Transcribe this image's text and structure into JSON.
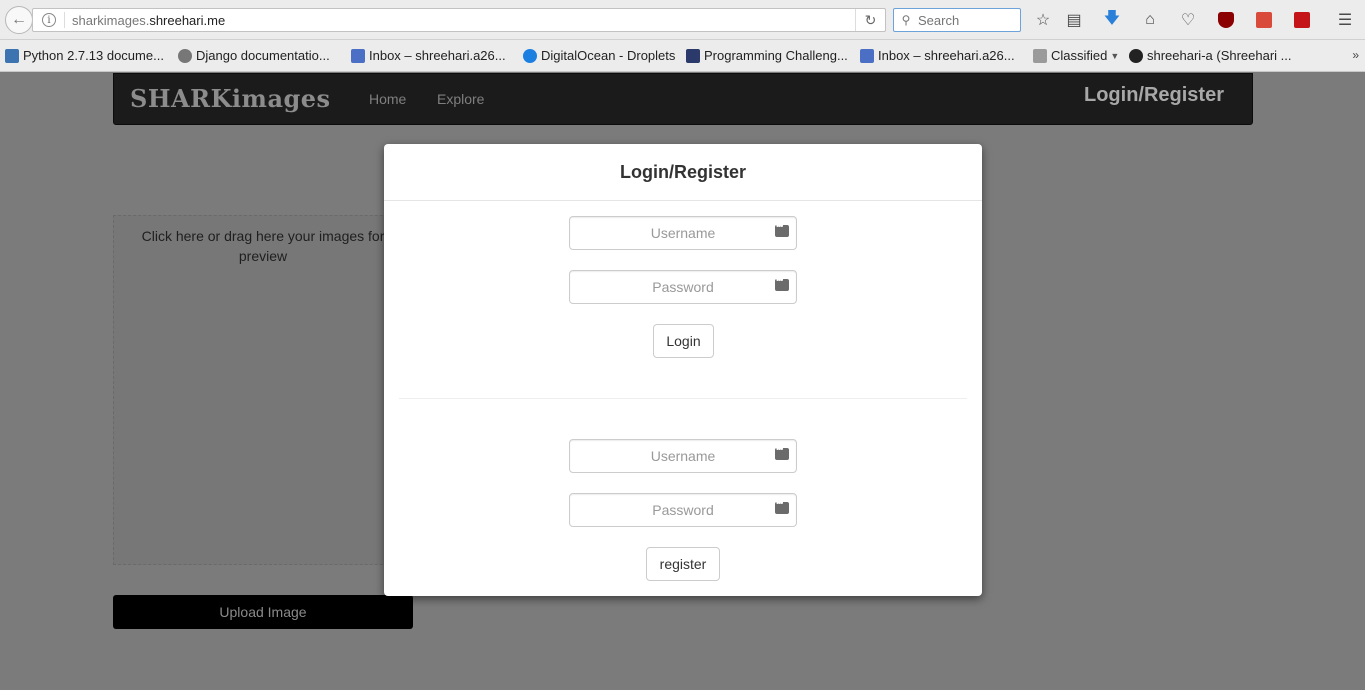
{
  "browser": {
    "url_prefix": "sharkimages.",
    "url_domain": "shreehari.me",
    "search_placeholder": "Search"
  },
  "bookmarks": [
    {
      "label": "Python 2.7.13 docume...",
      "icon_color": "#3b74b0"
    },
    {
      "label": "Django documentatio...",
      "icon_color": "#777777"
    },
    {
      "label": "Inbox – shreehari.a26...",
      "icon_color": "#4a6fc4"
    },
    {
      "label": "DigitalOcean - Droplets",
      "icon_color": "#1a7fe0"
    },
    {
      "label": "Programming Challeng...",
      "icon_color": "#2b3a6b"
    },
    {
      "label": "Inbox – shreehari.a26...",
      "icon_color": "#4a6fc4"
    },
    {
      "label": "Classified",
      "icon_color": "#9a9a9a"
    },
    {
      "label": "shreehari-a (Shreehari ...",
      "icon_color": "#222222"
    }
  ],
  "navbar": {
    "brand": "SHARKimages",
    "home": "Home",
    "explore": "Explore",
    "login_register": "Login/Register"
  },
  "dropzone": {
    "text": "Click here or drag here your images for preview"
  },
  "upload": {
    "label": "Upload Image"
  },
  "modal": {
    "title": "Login/Register",
    "login": {
      "username_placeholder": "Username",
      "password_placeholder": "Password",
      "button": "Login"
    },
    "register": {
      "username_placeholder": "Username",
      "password_placeholder": "Password",
      "button": "register"
    }
  }
}
